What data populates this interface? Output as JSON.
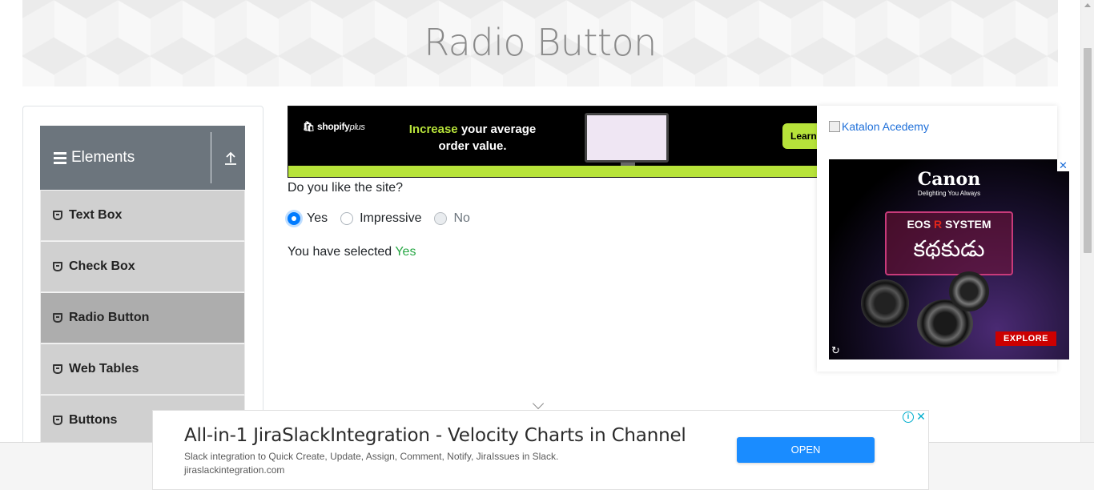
{
  "header": {
    "title": "Radio Button"
  },
  "sidebar": {
    "group_title": "Elements",
    "items": [
      {
        "label": "Text Box"
      },
      {
        "label": "Check Box"
      },
      {
        "label": "Radio Button"
      },
      {
        "label": "Web Tables"
      },
      {
        "label": "Buttons"
      }
    ],
    "active_item": "Radio Button"
  },
  "top_ad": {
    "brand": "shopify",
    "brand_suffix": "plus",
    "headline_highlight": "Increase",
    "headline_rest": " your average order value.",
    "cta": "Learn"
  },
  "main": {
    "question": "Do you like the site?",
    "options": [
      {
        "label": "Yes",
        "checked": true,
        "disabled": false
      },
      {
        "label": "Impressive",
        "checked": false,
        "disabled": false
      },
      {
        "label": "No",
        "checked": false,
        "disabled": true
      }
    ],
    "result_prefix": "You have selected ",
    "result_value": "Yes"
  },
  "right_ad": {
    "katalon_link": "Katalon Acedemy",
    "canon_logo": "Canon",
    "canon_tagline": "Delighting You Always",
    "eos_prefix": "EOS",
    "eos_r": "R",
    "eos_suffix": " SYSTEM",
    "eos_script": "కథకుడు",
    "explore": "EXPLORE",
    "close_glyph": "✕",
    "replay_glyph": "↻"
  },
  "bottom_ad": {
    "title": "All-in-1 JiraSlackIntegration - Velocity Charts in Channel",
    "description": "Slack integration to Quick Create, Update, Assign, Comment, Notify, JiraIssues in Slack.",
    "url": "jiraslackintegration.com",
    "button": "OPEN",
    "info_glyph": "i",
    "close_glyph": "✕"
  },
  "colors": {
    "accent": "#007bff",
    "success": "#28a745",
    "sidebar_header": "#6c757d",
    "sidebar_item": "#d0d0d0",
    "sidebar_active": "#adadad"
  }
}
